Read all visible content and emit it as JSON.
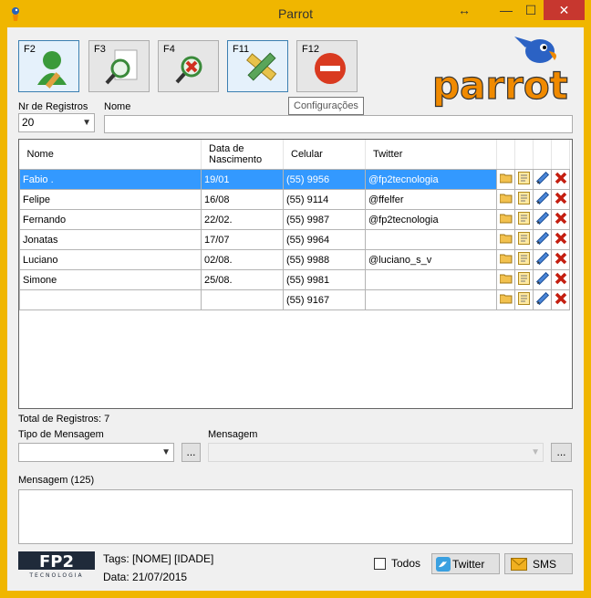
{
  "window": {
    "title": "Parrot"
  },
  "toolbar": {
    "buttons": [
      {
        "key": "F2",
        "name": "add-user"
      },
      {
        "key": "F3",
        "name": "search"
      },
      {
        "key": "F4",
        "name": "remove-search"
      },
      {
        "key": "F11",
        "name": "settings"
      },
      {
        "key": "F12",
        "name": "exit"
      }
    ],
    "tooltip": "Configurações"
  },
  "logo": {
    "text": "parrot"
  },
  "filters": {
    "records_label": "Nr de Registros",
    "records_value": "20",
    "name_label": "Nome",
    "name_value": ""
  },
  "grid": {
    "columns": [
      "Nome",
      "Data de Nascimento",
      "Celular",
      "Twitter"
    ],
    "rows": [
      {
        "nome": "Fabio .",
        "nasc": "19/01",
        "cel": "(55) 9956",
        "tw": "@fp2tecnologia",
        "selected": true
      },
      {
        "nome": "Felipe",
        "nasc": "16/08",
        "cel": "(55) 9114",
        "tw": "@ffelfer"
      },
      {
        "nome": "Fernando",
        "nasc": "22/02.",
        "cel": "(55) 9987",
        "tw": "@fp2tecnologia"
      },
      {
        "nome": "Jonatas",
        "nasc": "17/07",
        "cel": "(55) 9964",
        "tw": ""
      },
      {
        "nome": "Luciano",
        "nasc": "02/08.",
        "cel": "(55) 9988",
        "tw": "@luciano_s_v"
      },
      {
        "nome": "Simone",
        "nasc": "25/08.",
        "cel": "(55) 9981",
        "tw": ""
      },
      {
        "nome": "",
        "nasc": "",
        "cel": "(55) 9167",
        "tw": ""
      }
    ]
  },
  "footer": {
    "total": "Total de Registros: 7",
    "tipo_label": "Tipo de Mensagem",
    "tipo_value": "",
    "tipo_btn": "...",
    "msg_label": "Mensagem",
    "msg_value": "",
    "msg_btn": "...",
    "counter_label": "Mensagem (125)",
    "tags": "Tags: [NOME]  [IDADE]",
    "date": "Data: 21/07/2015",
    "todos_label": "Todos",
    "twitter_btn": "Twitter",
    "sms_btn": "SMS",
    "company_logo": "FP2",
    "company_tag": "TECNOLOGIA"
  },
  "colors": {
    "frame": "#f0b600",
    "selection": "#3399ff",
    "close": "#c7372f",
    "logo_orange": "#f08a00"
  }
}
